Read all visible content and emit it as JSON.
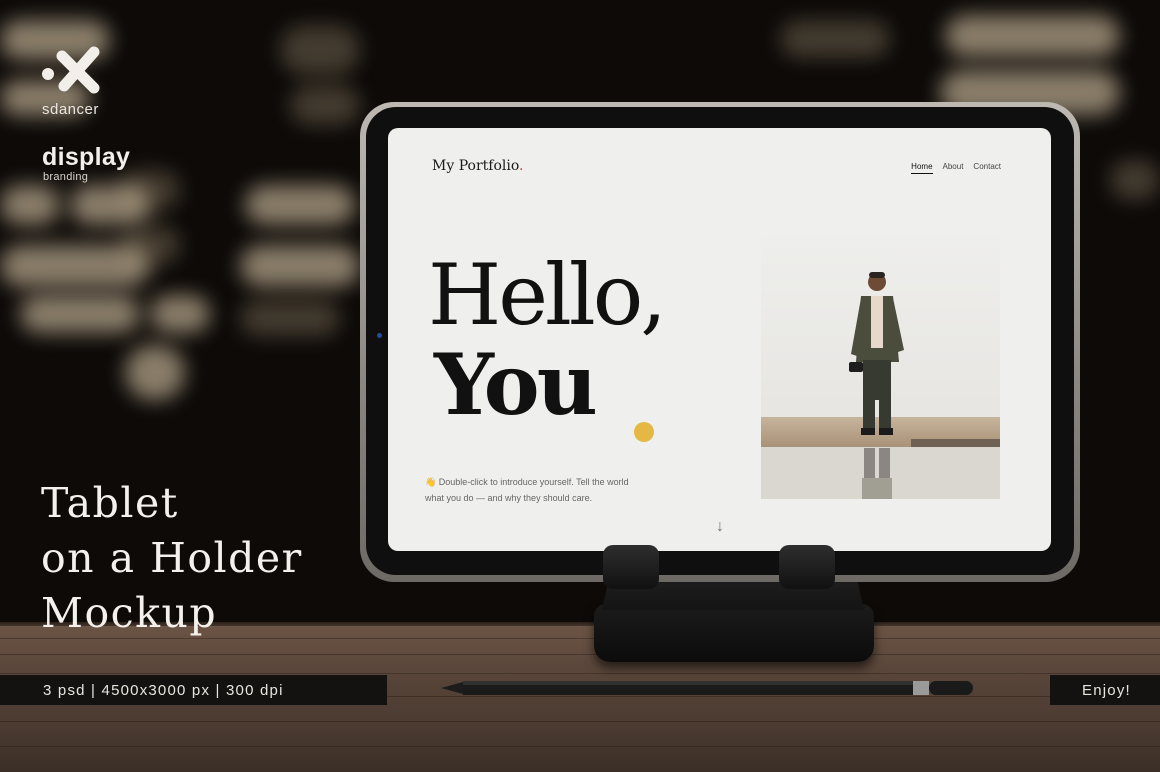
{
  "brand": {
    "logo_text": "sdancer",
    "title": "display",
    "subtitle": "branding"
  },
  "headline": {
    "line1": "Tablet",
    "line2": "on a Holder",
    "line3": "Mockup"
  },
  "specs": "3 psd | 4500x3000 px | 300 dpi",
  "enjoy": "Enjoy!",
  "screen": {
    "site_title": "My Portfolio",
    "site_dot": ".",
    "nav": [
      "Home",
      "About",
      "Contact"
    ],
    "hero_line1": "Hello,",
    "hero_line2": "You",
    "intro_line1": "👋 Double-click to introduce yourself. Tell the world",
    "intro_line2": "what you do — and why they should care.",
    "scroll_arrow": "↓"
  },
  "colors": {
    "accent_dot": "#e5b843",
    "logo_dot": "#d6443c"
  }
}
